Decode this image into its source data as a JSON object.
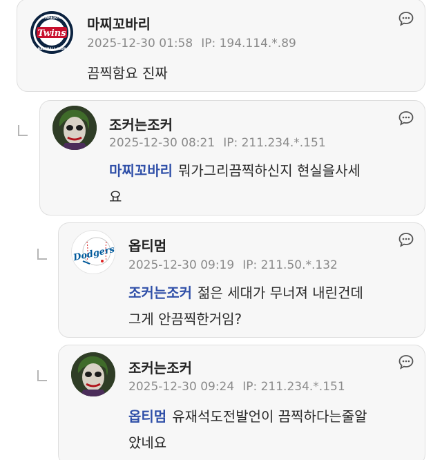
{
  "comments": [
    {
      "nickname": "마찌꼬바리",
      "date": "2025-12-30 01:58",
      "ip": "IP: 194.114.*.89",
      "mention": "",
      "text": "끔찍함요 진짜",
      "avatar": "minnesota-twins-logo"
    },
    {
      "nickname": "조커는조커",
      "date": "2025-12-30 08:21",
      "ip": "IP: 211.234.*.151",
      "mention": "마찌꼬바리",
      "text_line1": "뭐가그리끔찍하신지 현실을사세",
      "text_line2": "요",
      "avatar": "joker-avatar"
    },
    {
      "nickname": "옵티멈",
      "date": "2025-12-30 09:19",
      "ip": "IP: 211.50.*.132",
      "mention": "조커는조커",
      "text_line1": "젊은 세대가 무너져 내린건데",
      "text_line2": "그게 안끔찍한거임?",
      "avatar": "dodgers-logo"
    },
    {
      "nickname": "조커는조커",
      "date": "2025-12-30 09:24",
      "ip": "IP: 211.234.*.151",
      "mention": "옵티멈",
      "text_line1": "유재석도전발언이 끔찍하다는줄알",
      "text_line2": "았네요",
      "avatar": "joker-avatar"
    }
  ],
  "logos": {
    "twins_top": "MINNESOTA",
    "twins_main": "Twins",
    "twins_bottom": "BASEBALL CLUB",
    "dodgers": "Dodgers"
  }
}
